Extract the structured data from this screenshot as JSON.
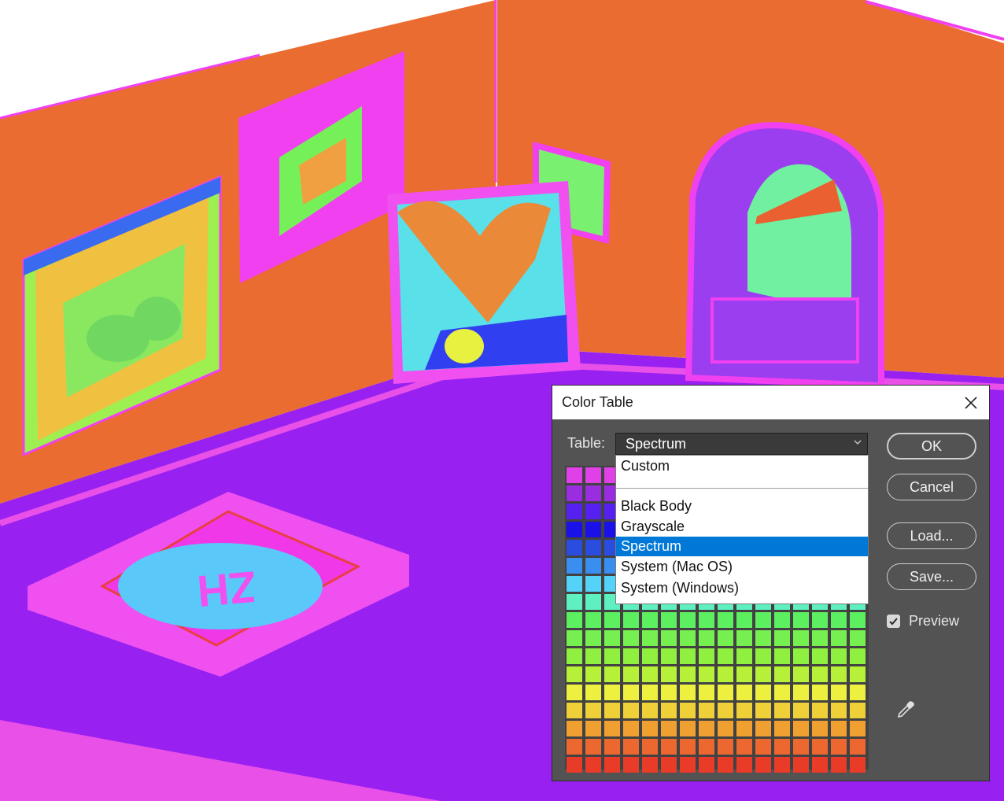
{
  "dialog": {
    "title": "Color Table",
    "table_label": "Table:",
    "selected_table": "Spectrum",
    "options": [
      "Custom",
      "Black Body",
      "Grayscale",
      "Spectrum",
      "System (Mac OS)",
      "System (Windows)"
    ],
    "highlighted_option": "Spectrum",
    "buttons": {
      "ok": "OK",
      "cancel": "Cancel",
      "load": "Load...",
      "save": "Save..."
    },
    "preview_label": "Preview",
    "preview_checked": true,
    "icons": {
      "close": "close-icon",
      "dropdown": "chevron-down-icon",
      "eyedropper": "eyedropper-icon",
      "checkmark": "checkmark-icon"
    },
    "swatch_rows": [
      "#e040e8",
      "#9b2de0",
      "#5520f0",
      "#1a10e8",
      "#2a4de0",
      "#3a8ef0",
      "#55d2f8",
      "#5ef0c0",
      "#5cf060",
      "#76f050",
      "#90f040",
      "#b6f038",
      "#eef040",
      "#f0d038",
      "#f0a030",
      "#ec6830",
      "#e83c28"
    ]
  },
  "scene": {
    "colors": {
      "wall": "#ea6c30",
      "floor": "#9820f0",
      "floor_edge": "#e850e8",
      "accent": "#f040f0"
    }
  }
}
